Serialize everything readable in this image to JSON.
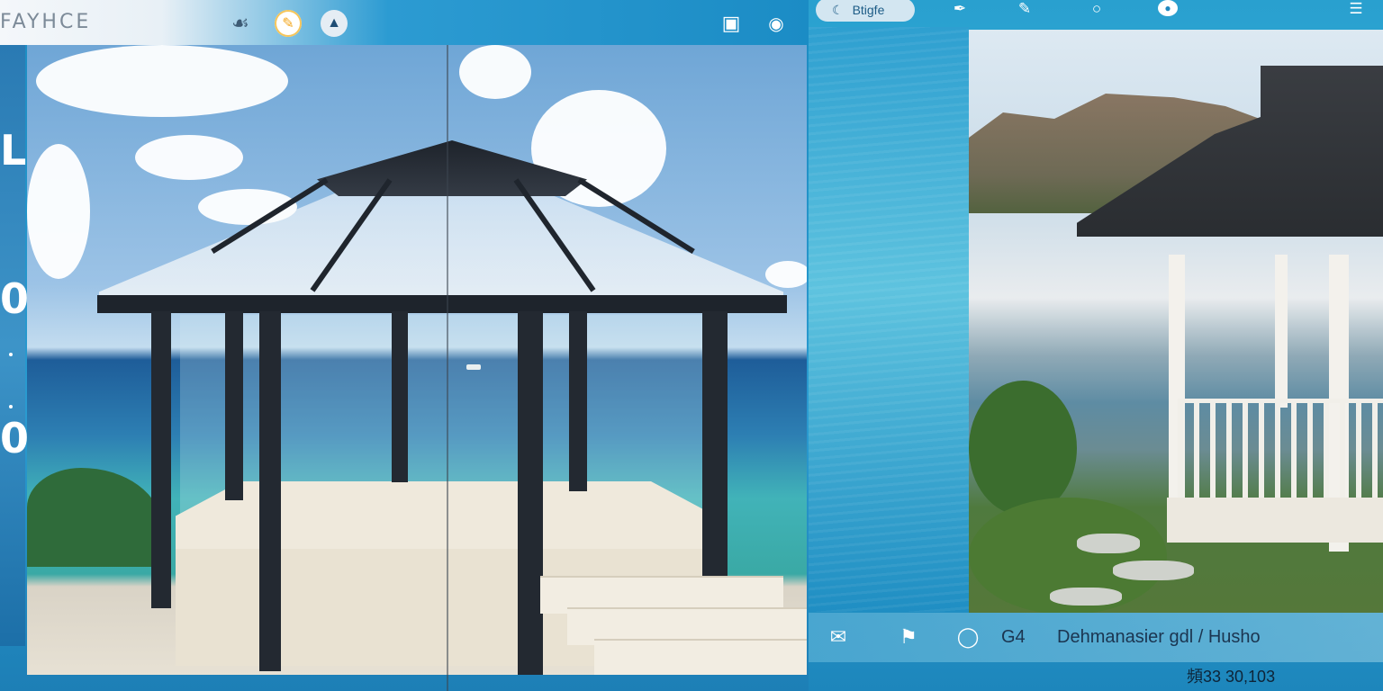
{
  "brand": "FAYHCE",
  "left_panel": {
    "toolbar_icons": [
      "brush-icon",
      "pencil-icon",
      "sailboat-icon",
      "window-icon",
      "eye-icon"
    ],
    "side_glyphs": [
      "L",
      "0",
      "0"
    ]
  },
  "right_panel": {
    "search_label": "Btigfe",
    "toolbar_icons": [
      "pen-icon",
      "edit-icon",
      "circle-icon",
      "globe-icon",
      "menu-icon"
    ],
    "bottom_bar": {
      "icons": [
        "folder-icon",
        "flag-icon",
        "record-icon"
      ],
      "code": "G4",
      "title": "Dehmanasier gdl / Husho",
      "coordinates": "頻33 30,103"
    }
  },
  "colors": {
    "accent_blue": "#1f86b8",
    "toolbar_white": "#f4f7fa",
    "text_dark": "#1b3550"
  }
}
